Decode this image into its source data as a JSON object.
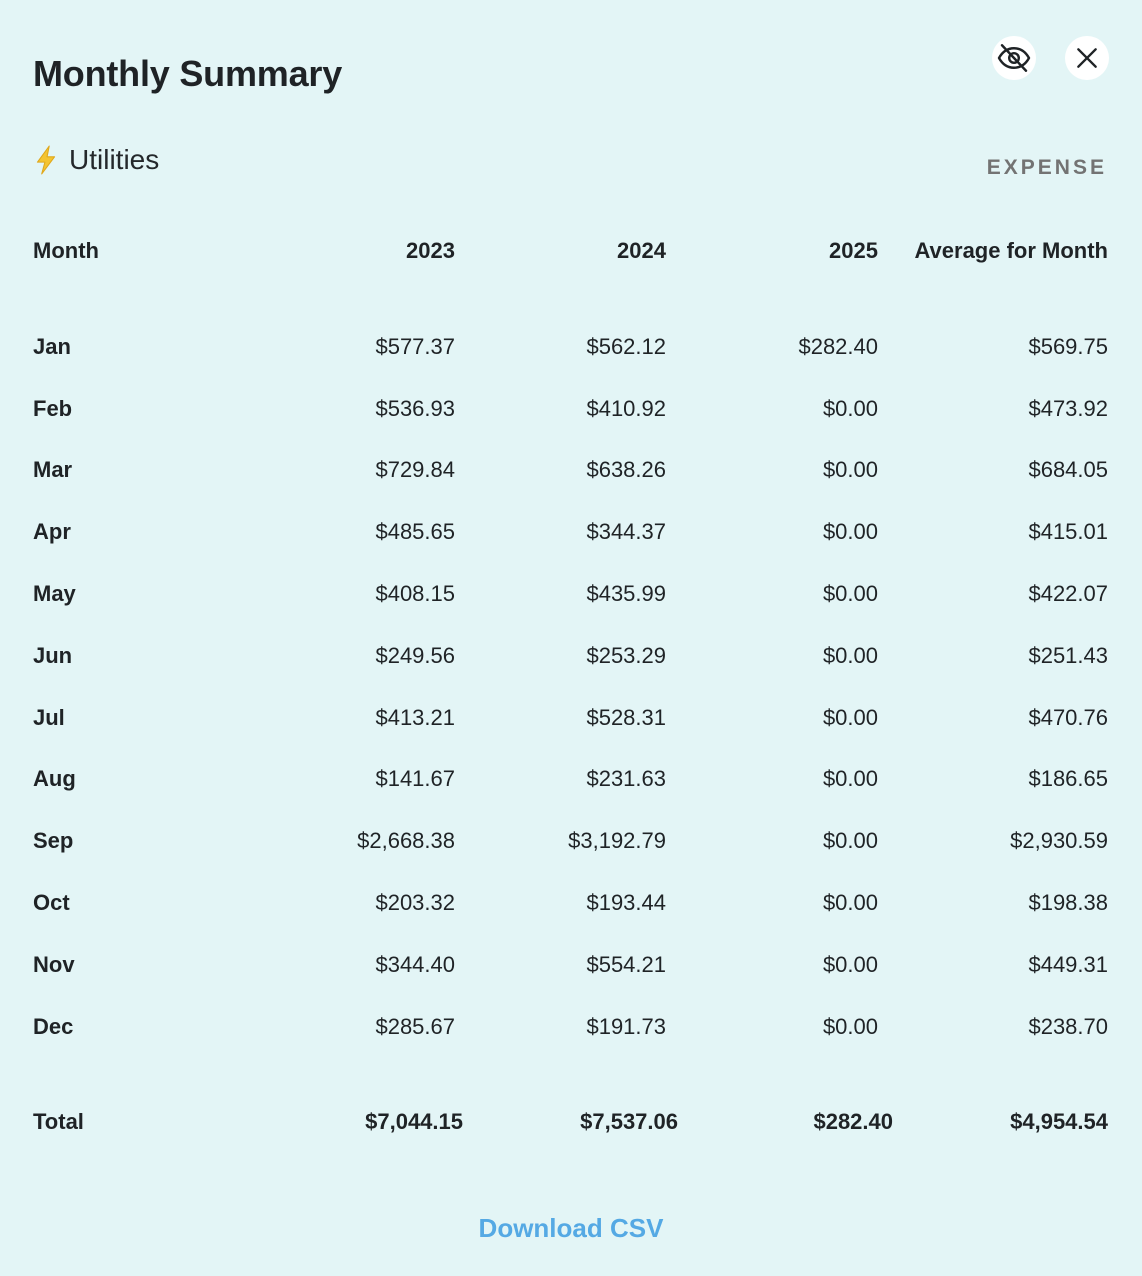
{
  "header": {
    "title": "Monthly Summary",
    "hide_icon": "eye-slash-icon",
    "close_icon": "close-icon"
  },
  "category": {
    "icon": "lightning-bolt-icon",
    "label": "Utilities",
    "type": "EXPENSE"
  },
  "colors": {
    "background": "#e3f5f6",
    "accent_link": "#55a9e4",
    "bolt": "#f4c430",
    "muted": "#737373"
  },
  "table": {
    "columns": [
      "Month",
      "2023",
      "2024",
      "2025",
      "Average for Month"
    ],
    "rows": [
      {
        "month": "Jan",
        "y2023": "$577.37",
        "y2024": "$562.12",
        "y2025": "$282.40",
        "avg": "$569.75"
      },
      {
        "month": "Feb",
        "y2023": "$536.93",
        "y2024": "$410.92",
        "y2025": "$0.00",
        "avg": "$473.92"
      },
      {
        "month": "Mar",
        "y2023": "$729.84",
        "y2024": "$638.26",
        "y2025": "$0.00",
        "avg": "$684.05"
      },
      {
        "month": "Apr",
        "y2023": "$485.65",
        "y2024": "$344.37",
        "y2025": "$0.00",
        "avg": "$415.01"
      },
      {
        "month": "May",
        "y2023": "$408.15",
        "y2024": "$435.99",
        "y2025": "$0.00",
        "avg": "$422.07"
      },
      {
        "month": "Jun",
        "y2023": "$249.56",
        "y2024": "$253.29",
        "y2025": "$0.00",
        "avg": "$251.43"
      },
      {
        "month": "Jul",
        "y2023": "$413.21",
        "y2024": "$528.31",
        "y2025": "$0.00",
        "avg": "$470.76"
      },
      {
        "month": "Aug",
        "y2023": "$141.67",
        "y2024": "$231.63",
        "y2025": "$0.00",
        "avg": "$186.65"
      },
      {
        "month": "Sep",
        "y2023": "$2,668.38",
        "y2024": "$3,192.79",
        "y2025": "$0.00",
        "avg": "$2,930.59"
      },
      {
        "month": "Oct",
        "y2023": "$203.32",
        "y2024": "$193.44",
        "y2025": "$0.00",
        "avg": "$198.38"
      },
      {
        "month": "Nov",
        "y2023": "$344.40",
        "y2024": "$554.21",
        "y2025": "$0.00",
        "avg": "$449.31"
      },
      {
        "month": "Dec",
        "y2023": "$285.67",
        "y2024": "$191.73",
        "y2025": "$0.00",
        "avg": "$238.70"
      }
    ],
    "total": {
      "label": "Total",
      "y2023": "$7,044.15",
      "y2024": "$7,537.06",
      "y2025": "$282.40",
      "avg": "$4,954.54"
    }
  },
  "footer": {
    "download_label": "Download CSV"
  }
}
